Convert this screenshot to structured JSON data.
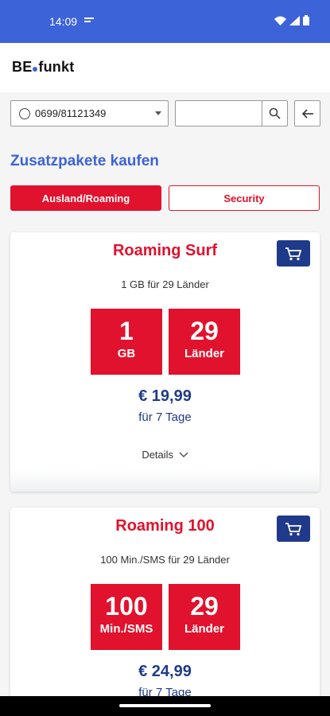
{
  "status_bar": {
    "time": "14:09",
    "notification_icon": "message-icon",
    "icons": [
      "wifi-icon",
      "signal-icon",
      "battery-icon"
    ]
  },
  "app": {
    "logo_left": "BE",
    "logo_right": "funkt",
    "accent": "#3d63d8",
    "red": "#e1122d",
    "navy": "#1f3a8a"
  },
  "controls": {
    "phone_number": "0699/81121349",
    "search_placeholder": ""
  },
  "section_title": "Zusatzpakete kaufen",
  "tabs": [
    {
      "label": "Ausland/Roaming",
      "active": true
    },
    {
      "label": "Security",
      "active": false
    }
  ],
  "cards": [
    {
      "title": "Roaming Surf",
      "subtitle": "1 GB für 29 Länder",
      "tiles": [
        {
          "big": "1",
          "small": "GB"
        },
        {
          "big": "29",
          "small": "Länder"
        }
      ],
      "price": "€ 19,99",
      "duration": "für 7 Tage",
      "details": "Details"
    },
    {
      "title": "Roaming 100",
      "subtitle": "100 Min./SMS für 29 Länder",
      "tiles": [
        {
          "big": "100",
          "small": "Min./SMS"
        },
        {
          "big": "29",
          "small": "Länder"
        }
      ],
      "price": "€ 24,99",
      "duration": "für 7 Tage"
    }
  ]
}
